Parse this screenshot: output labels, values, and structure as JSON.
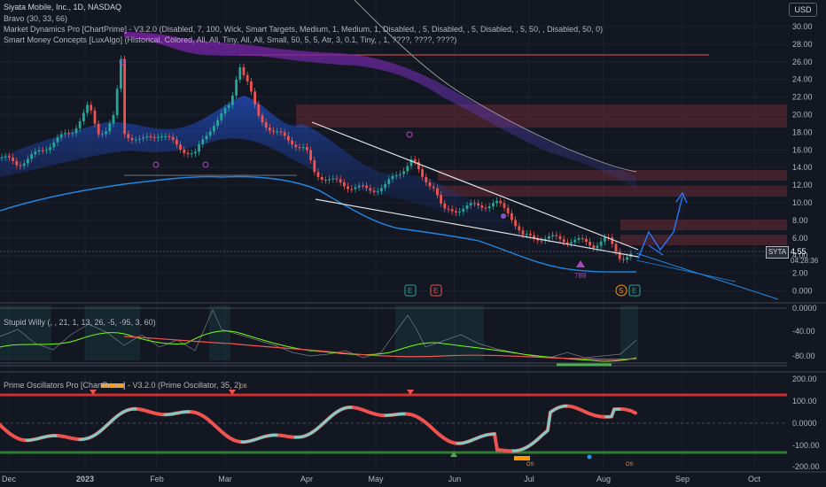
{
  "header": {
    "symbol_line": "Siyata Mobile, Inc., 1D, NASDAQ",
    "indicators": [
      "Bravo (30, 33, 66)",
      "Market Dynamics Pro [ChartPrime] - V3.2.0 (Disabled, 7, 100, Wick, Smart Targets, Medium, 1, Medium, 1, Disabled, , 5, Disabled, , 5, Disabled, , 5, 50, , Disabled, 50, 0)",
      "Smart Money Concepts [LuxAlgo] (Historical, Colored, All, All, Tiny, All, All, Small, 50, 5, 5, Atr, 3, 0.1, Tiny, , 1, ????, ????, ????)"
    ],
    "currency": "USD"
  },
  "price": {
    "ticker": "SYTA",
    "last": "4.55",
    "countdown": "04:28:36"
  },
  "axes": {
    "price_ticks": [
      "30.00",
      "28.00",
      "26.00",
      "24.00",
      "22.00",
      "20.00",
      "18.00",
      "16.00",
      "14.00",
      "12.00",
      "10.00",
      "8.00",
      "6.00",
      "4.00",
      "2.00",
      "0.000"
    ],
    "willy_ticks": [
      "0.0000",
      "-40.00",
      "-80.00"
    ],
    "osc_ticks": [
      "200.00",
      "100.00",
      "0.0000",
      "-100.00",
      "-200.00"
    ],
    "time_ticks": [
      "Dec",
      "2023",
      "Feb",
      "Mar",
      "Apr",
      "May",
      "Jun",
      "Jul",
      "Aug",
      "Sep",
      "Oct"
    ]
  },
  "panes": {
    "willy_title": "Stupid Willy (, , 21, 1, 13, 26, -5, -95, 3, 60)",
    "osc_title": "Prime Oscillators Pro [ChartPrime] - V3.2.0 (Prime Oscillator, 35, 2)"
  },
  "markers": {
    "e1": "E",
    "e2": "E",
    "s": "S",
    "e3": "E",
    "count": "789",
    "os1": "OS",
    "os2": "OS",
    "ob": "OB"
  },
  "colors": {
    "background": "#131722",
    "bull": "#26a69a",
    "bear": "#ef5350",
    "ribbon_blue": "#2962ff",
    "ribbon_purple": "#9c27b0",
    "zone": "#7a2e3a"
  }
}
